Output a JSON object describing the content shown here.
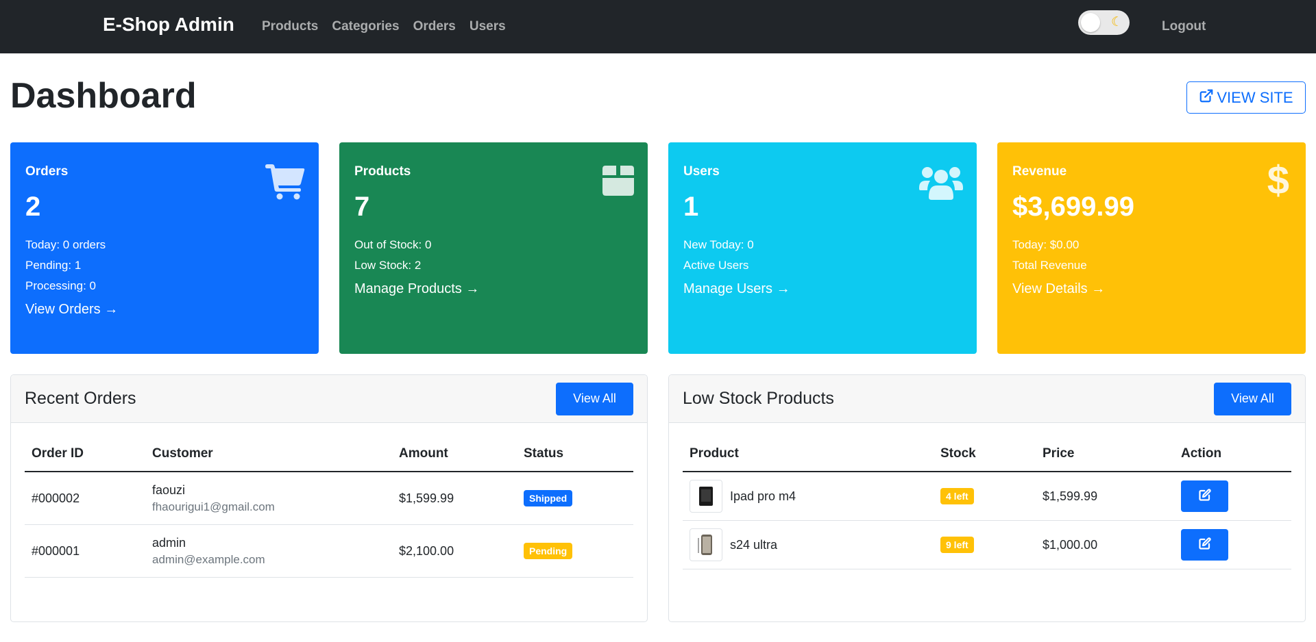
{
  "navbar": {
    "brand": "E-Shop Admin",
    "links": [
      "Products",
      "Categories",
      "Orders",
      "Users"
    ],
    "logout": "Logout",
    "theme_toggle": {
      "state": "light",
      "icon": "moon-icon"
    }
  },
  "header": {
    "title": "Dashboard",
    "view_site_label": "VIEW SITE"
  },
  "stats": {
    "orders": {
      "title": "Orders",
      "value": "2",
      "lines": [
        "Today: 0 orders",
        "Pending: 1",
        "Processing: 0"
      ],
      "link": "View Orders →",
      "icon": "cart-icon",
      "color": "#0d6efd"
    },
    "products": {
      "title": "Products",
      "value": "7",
      "lines": [
        "Out of Stock: 0",
        "Low Stock: 2"
      ],
      "link": "Manage Products →",
      "icon": "box-icon",
      "color": "#198754"
    },
    "users": {
      "title": "Users",
      "value": "1",
      "lines": [
        "New Today: 0",
        "Active Users"
      ],
      "link": "Manage Users →",
      "icon": "users-icon",
      "color": "#0dcaf0"
    },
    "revenue": {
      "title": "Revenue",
      "value": "$3,699.99",
      "lines": [
        "Today: $0.00",
        "Total Revenue"
      ],
      "link": "View Details →",
      "icon": "dollar-icon",
      "color": "#ffc107"
    }
  },
  "recent_orders": {
    "title": "Recent Orders",
    "view_all": "View All",
    "columns": [
      "Order ID",
      "Customer",
      "Amount",
      "Status"
    ],
    "rows": [
      {
        "id": "#000002",
        "name": "faouzi",
        "email": "fhaourigui1@gmail.com",
        "amount": "$1,599.99",
        "status": "Shipped",
        "status_color": "#0d6efd"
      },
      {
        "id": "#000001",
        "name": "admin",
        "email": "admin@example.com",
        "amount": "$2,100.00",
        "status": "Pending",
        "status_color": "#ffc107"
      }
    ]
  },
  "low_stock": {
    "title": "Low Stock Products",
    "view_all": "View All",
    "columns": [
      "Product",
      "Stock",
      "Price",
      "Action"
    ],
    "rows": [
      {
        "product": "Ipad pro m4",
        "stock": "4 left",
        "price": "$1,599.99",
        "action_icon": "edit-icon"
      },
      {
        "product": "s24 ultra",
        "stock": "9 left",
        "price": "$1,000.00",
        "action_icon": "edit-icon"
      }
    ]
  }
}
